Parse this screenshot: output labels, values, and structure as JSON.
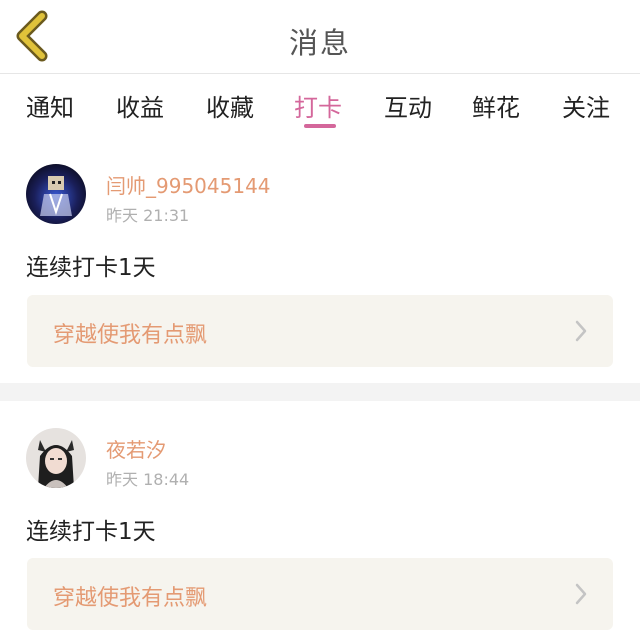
{
  "header": {
    "title": "消息",
    "back_icon": "chevron-left-icon",
    "accent_color": "#e0c23a"
  },
  "tabs": [
    {
      "label": "通知",
      "active": false
    },
    {
      "label": "收益",
      "active": false
    },
    {
      "label": "收藏",
      "active": false
    },
    {
      "label": "打卡",
      "active": true
    },
    {
      "label": "互动",
      "active": false
    },
    {
      "label": "鲜花",
      "active": false
    },
    {
      "label": "关注",
      "active": false
    }
  ],
  "posts": [
    {
      "username": "闫帅_995045144",
      "time": "昨天 21:31",
      "content": "连续打卡1天",
      "link_title": "穿越使我有点飘"
    },
    {
      "username": "夜若汐",
      "time": "昨天 18:44",
      "content": "连续打卡1天",
      "link_title": "穿越使我有点飘"
    }
  ],
  "colors": {
    "active_tab": "#d4679b",
    "username": "#e49a73",
    "card_bg": "#f6f4ee"
  }
}
